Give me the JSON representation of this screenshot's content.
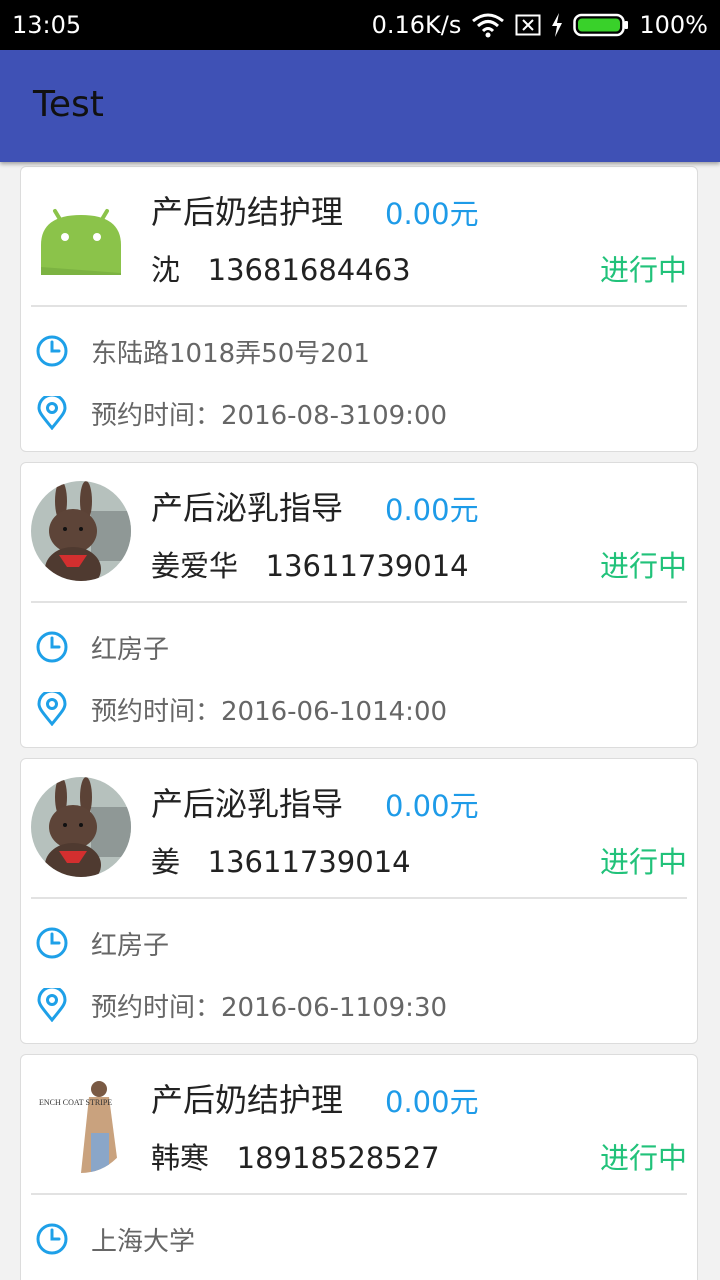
{
  "status_bar": {
    "time": "13:05",
    "speed": "0.16K/s",
    "battery": "100%",
    "icons": [
      "wifi-icon",
      "sim-missing-icon",
      "charging-icon",
      "battery-icon"
    ]
  },
  "app_bar": {
    "title": "Test"
  },
  "colors": {
    "app_bar": "#3f51b5",
    "price": "#1e9be8",
    "status": "#21c27a",
    "icon": "#1ea0e8"
  },
  "orders": [
    {
      "avatar": "android-robot-icon",
      "service": "产后奶结护理",
      "price": "0.00元",
      "client": "沈   13681684463",
      "status": "进行中",
      "address": "东陆路1018弄50号201",
      "appointment": "预约时间：2016-08-3109:00"
    },
    {
      "avatar": "plush-bunny-photo",
      "service": "产后泌乳指导",
      "price": "0.00元",
      "client": "姜爱华   13611739014",
      "status": "进行中",
      "address": "红房子",
      "appointment": "预约时间：2016-06-1014:00"
    },
    {
      "avatar": "plush-bunny-photo",
      "service": "产后泌乳指导",
      "price": "0.00元",
      "client": "姜   13611739014",
      "status": "进行中",
      "address": "红房子",
      "appointment": "预约时间：2016-06-1109:30"
    },
    {
      "avatar": "trench-coat-photo",
      "avatar_text": "ENCH COAT STRIPE",
      "service": "产后奶结护理",
      "price": "0.00元",
      "client": "韩寒   18918528527",
      "status": "进行中",
      "address": "上海大学",
      "appointment": ""
    }
  ]
}
